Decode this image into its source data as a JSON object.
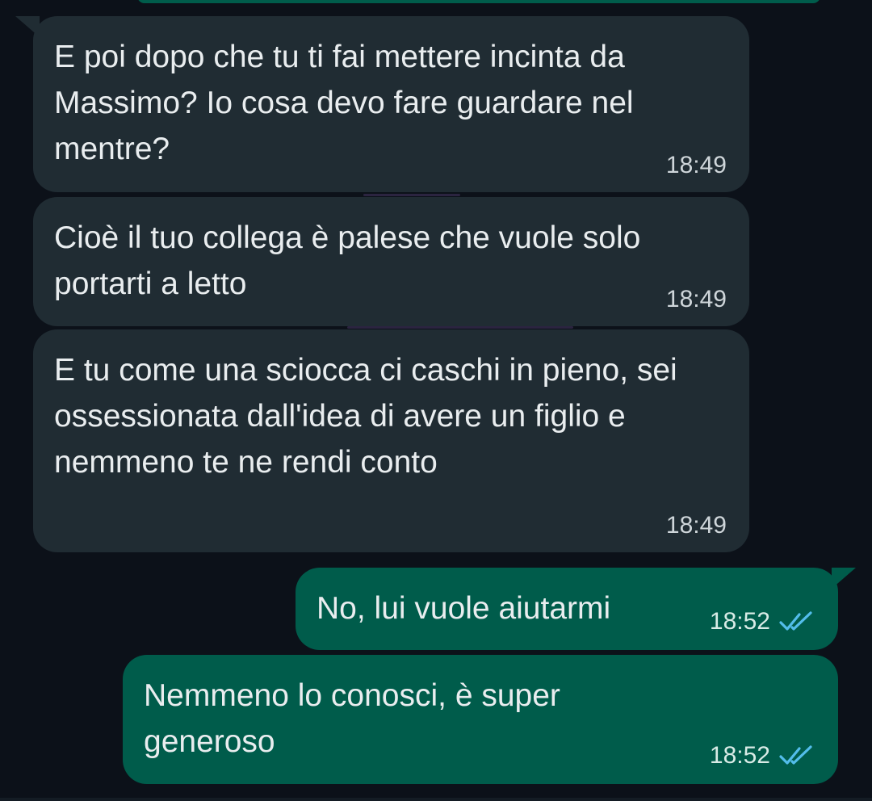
{
  "chat": {
    "accent_incoming": "#202c33",
    "accent_outgoing": "#005c4b",
    "read_tick_color": "#53bdeb",
    "messages": [
      {
        "direction": "incoming",
        "text": "E poi dopo che tu ti fai mettere incinta da Massimo? Io cosa devo fare guardare nel mentre?",
        "time": "18:49"
      },
      {
        "direction": "incoming",
        "text": "Cioè il tuo collega è palese che vuole solo portarti a letto",
        "time": "18:49"
      },
      {
        "direction": "incoming",
        "text": "E tu come una sciocca ci caschi in pieno, sei ossessionata dall'idea di avere un figlio e nemmeno te ne rendi conto",
        "time": "18:49"
      },
      {
        "direction": "outgoing",
        "text": "No, lui vuole aiutarmi",
        "time": "18:52",
        "status_icon": "double-check-read-icon"
      },
      {
        "direction": "outgoing",
        "text": "Nemmeno lo conosci, è super generoso",
        "time": "18:52",
        "status_icon": "double-check-read-icon"
      }
    ]
  }
}
